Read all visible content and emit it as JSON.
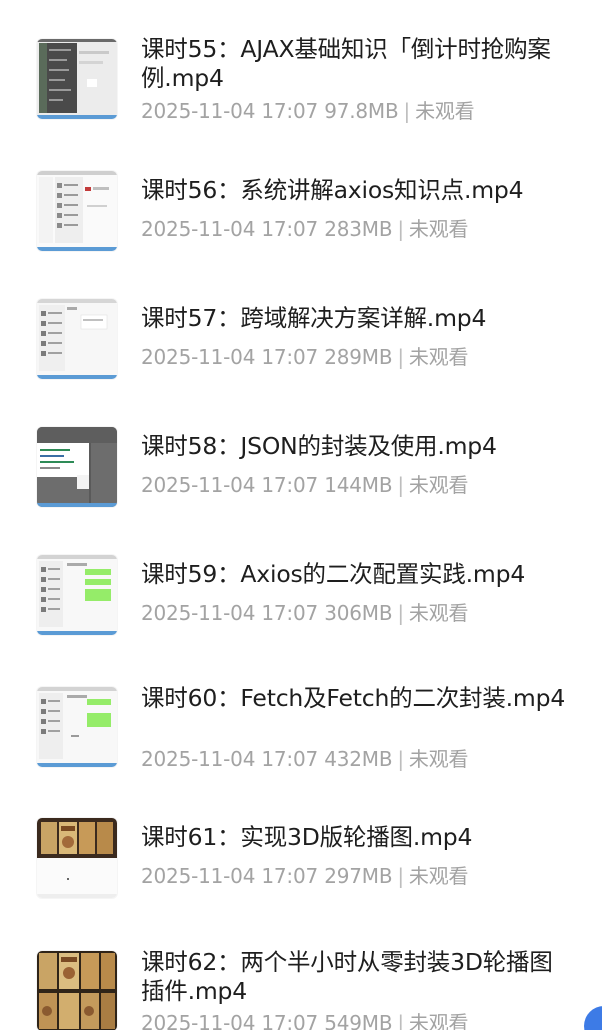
{
  "videos": [
    {
      "title": "课时55：AJAX基础知识「倒计时抢购案例.mp4",
      "date": "2025-11-04 17:07",
      "size": "97.8MB",
      "status": "未观看",
      "thumb": "gray-screen"
    },
    {
      "title": "课时56：系统讲解axios知识点.mp4",
      "date": "2025-11-04 17:07",
      "size": "283MB",
      "status": "未观看",
      "thumb": "chat-screen"
    },
    {
      "title": "课时57：跨域解决方案详解.mp4",
      "date": "2025-11-04 17:07",
      "size": "289MB",
      "status": "未观看",
      "thumb": "chat-screen"
    },
    {
      "title": "课时58：JSON的封装及使用.mp4",
      "date": "2025-11-04 17:07",
      "size": "144MB",
      "status": "未观看",
      "thumb": "dark-screen"
    },
    {
      "title": "课时59：Axios的二次配置实践.mp4",
      "date": "2025-11-04 17:07",
      "size": "306MB",
      "status": "未观看",
      "thumb": "chat-green"
    },
    {
      "title": "课时60：Fetch及Fetch的二次封装.mp4",
      "date": "2025-11-04 17:07",
      "size": "432MB",
      "status": "未观看",
      "thumb": "chat-green"
    },
    {
      "title": "课时61：实现3D版轮播图.mp4",
      "date": "2025-11-04 17:07",
      "size": "297MB",
      "status": "未观看",
      "thumb": "poster-screen"
    },
    {
      "title": "课时62：两个半小时从零封装3D轮播图插件.mp4",
      "date": "2025-11-04 17:07",
      "size": "549MB",
      "status": "未观看",
      "thumb": "poster-full"
    }
  ],
  "colors": {
    "title": "#1e1e1e",
    "meta": "#a3a3a3",
    "accent": "#3d7be6"
  }
}
